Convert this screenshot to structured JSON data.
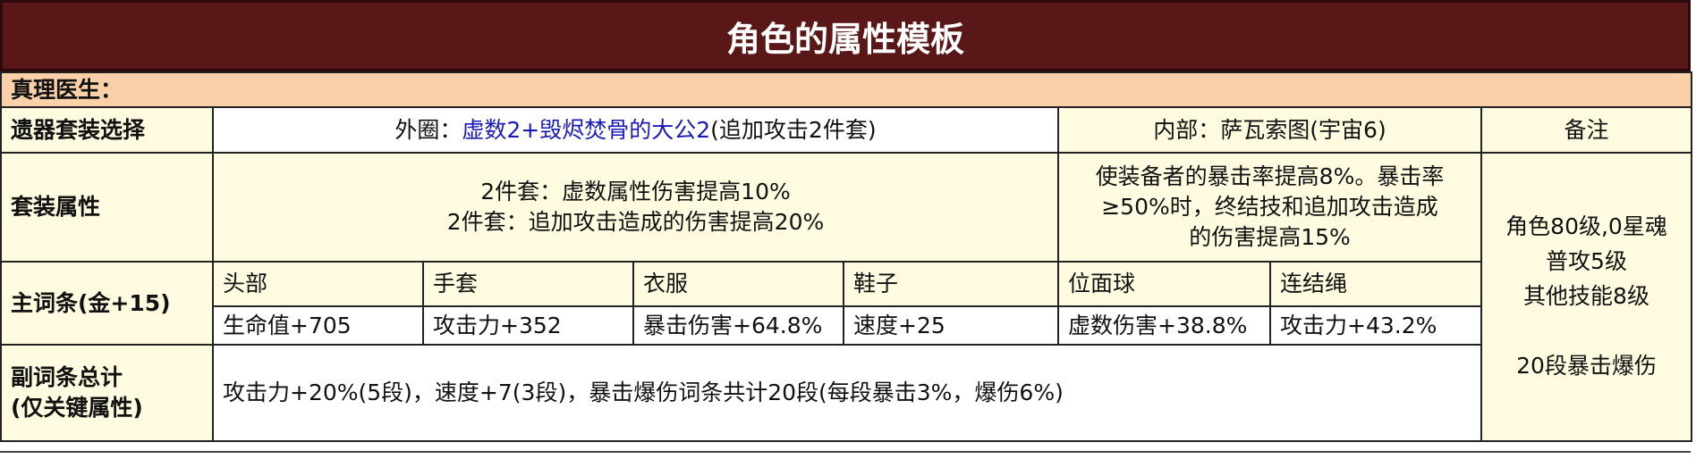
{
  "title": "角色的属性模板",
  "character": "真理医生：",
  "relic_row": {
    "label": "遗器套装选择",
    "outer_prefix": "外圈：",
    "outer_set": "虚数2+毁烬焚骨的大公2",
    "outer_suffix": "(追加攻击2件套)",
    "inner": "内部：萨瓦索图(宇宙6)",
    "notes_header": "备注"
  },
  "set_effects": {
    "label": "套装属性",
    "outer_lines": [
      "2件套：虚数属性伤害提高10%",
      "2件套：追加攻击造成的伤害提高20%"
    ],
    "inner_lines": [
      "使装备者的暴击率提高8%。暴击率",
      "≥50%时，终结技和追加攻击造成",
      "的伤害提高15%"
    ]
  },
  "main_stats": {
    "label": "主词条(金+15)",
    "slots": [
      {
        "slot": "头部",
        "stat": "生命值+705"
      },
      {
        "slot": "手套",
        "stat": "攻击力+352"
      },
      {
        "slot": "衣服",
        "stat": "暴击伤害+64.8%"
      },
      {
        "slot": "鞋子",
        "stat": "速度+25"
      },
      {
        "slot": "位面球",
        "stat": "虚数伤害+38.8%"
      },
      {
        "slot": "连结绳",
        "stat": "攻击力+43.2%"
      }
    ]
  },
  "substats": {
    "label_line1": "副词条总计",
    "label_line2": "(仅关键属性)",
    "text": "攻击力+20%(5段)，速度+7(3段)，暴击爆伤词条共计20段(每段暴击3%，爆伤6%)"
  },
  "notes": {
    "lines": [
      "角色80级,0星魂",
      "普攻5级",
      "其他技能8级"
    ],
    "extra": "20段暴击爆伤"
  }
}
